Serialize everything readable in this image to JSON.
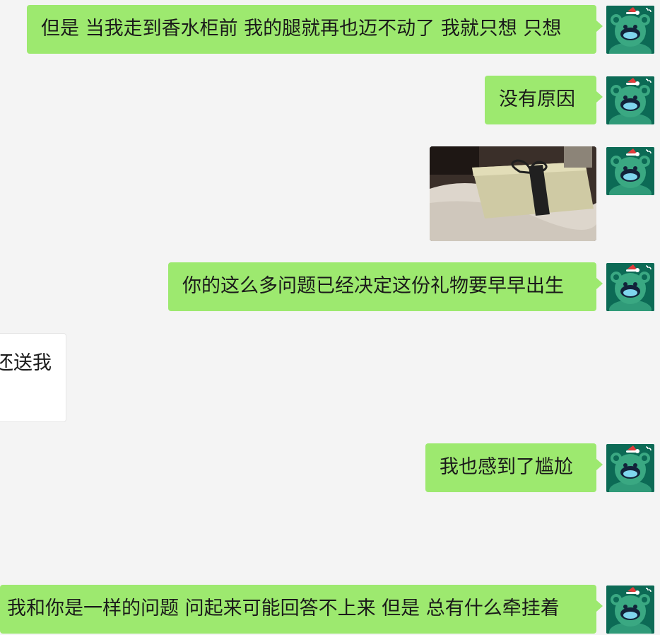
{
  "messages": [
    {
      "id": 1,
      "side": "out",
      "text": "但是 当我走到香水柜前 我的腿就再也迈不动了 我就只想 只想"
    },
    {
      "id": 2,
      "side": "out",
      "text": "没有原因"
    },
    {
      "id": 3,
      "side": "out",
      "type": "image",
      "image_icon": "gift-box-photo"
    },
    {
      "id": 4,
      "side": "out",
      "text": "你的这么多问题已经决定这份礼物要早早出生"
    },
    {
      "id": 5,
      "side": "in",
      "text": "还送我"
    },
    {
      "id": 6,
      "side": "out",
      "text": "我也感到了尴尬"
    },
    {
      "id": 7,
      "side": "out",
      "text": "我和你是一样的问题 问起来可能回答不上来 但是 总有什么牵挂着"
    }
  ],
  "avatar": {
    "icon": "green-bear-santa-hat-avatar"
  },
  "colors": {
    "background": "#f4f4f4",
    "outgoing_bubble": "#9de96f",
    "incoming_bubble": "#ffffff",
    "avatar_bg": "#0c6a55"
  }
}
